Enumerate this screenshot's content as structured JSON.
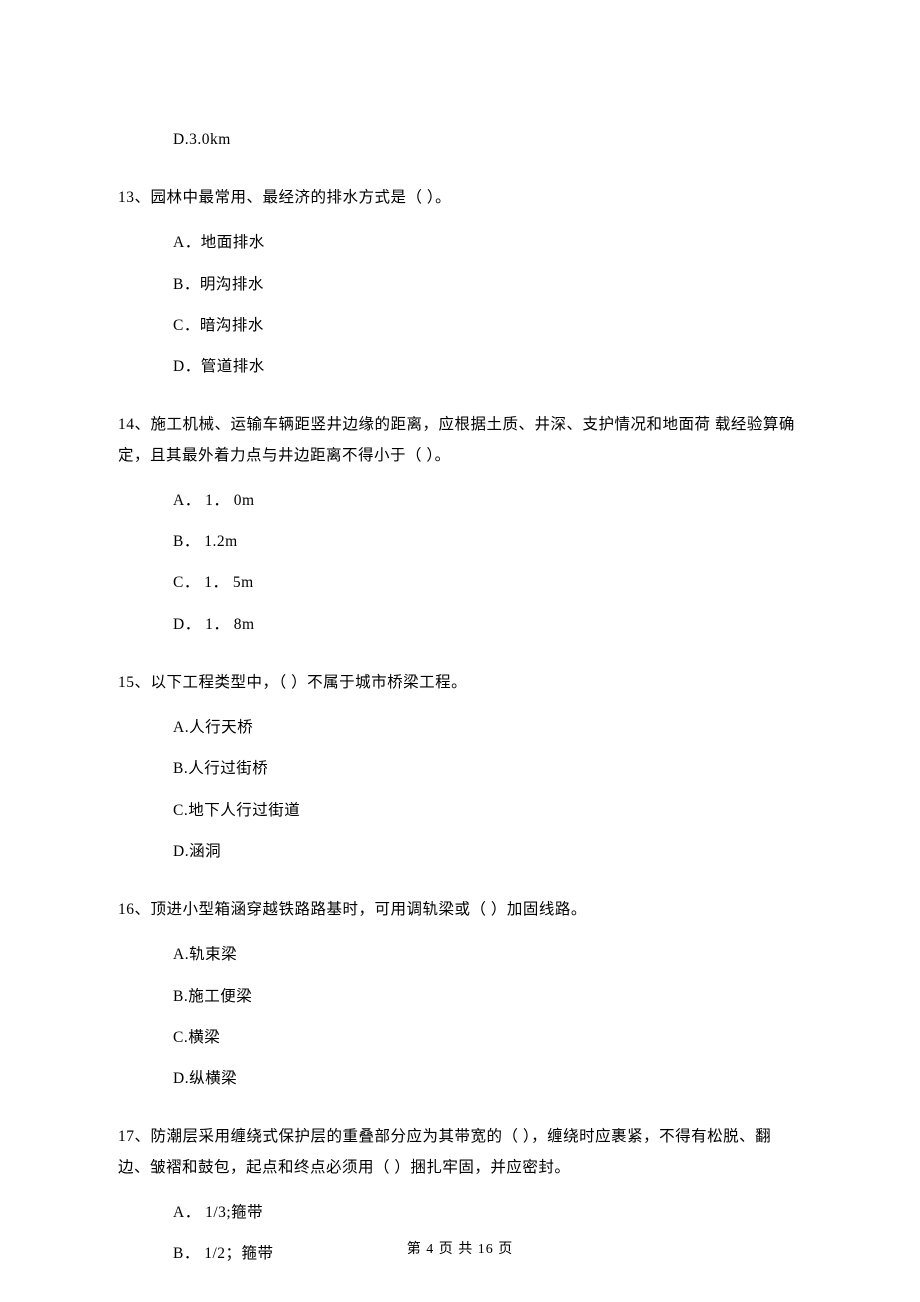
{
  "q12": {
    "optD": "D.3.0km"
  },
  "q13": {
    "stem": "13、园林中最常用、最经济的排水方式是（    ）。",
    "optA": "A．地面排水",
    "optB": "B．明沟排水",
    "optC": "C．暗沟排水",
    "optD": "D．管道排水"
  },
  "q14": {
    "stem": "14、施工机械、运输车辆距竖井边缘的距离，应根据土质、井深、支护情况和地面荷 载经验算确定，且其最外着力点与井边距离不得小于（    ）。",
    "optA": "A． 1． 0m",
    "optB": "B． 1.2m",
    "optC": "C． 1． 5m",
    "optD": "D． 1． 8m"
  },
  "q15": {
    "stem": "15、以下工程类型中，（    ）不属于城市桥梁工程。",
    "optA": "A.人行天桥",
    "optB": "B.人行过街桥",
    "optC": "C.地下人行过街道",
    "optD": "D.涵洞"
  },
  "q16": {
    "stem": "16、顶进小型箱涵穿越铁路路基时，可用调轨梁或（     ）加固线路。",
    "optA": "A.轨束梁",
    "optB": "B.施工便梁",
    "optC": "C.横梁",
    "optD": "D.纵横梁"
  },
  "q17": {
    "stem": "17、防潮层采用缠绕式保护层的重叠部分应为其带宽的（    ），缠绕时应裹紧，不得有松脱、翻边、皱褶和鼓包，起点和终点必须用（    ）捆扎牢固，并应密封。",
    "optA": "A． 1/3;箍带",
    "optB": "B． 1/2；箍带"
  },
  "footer": "第 4 页 共 16 页"
}
